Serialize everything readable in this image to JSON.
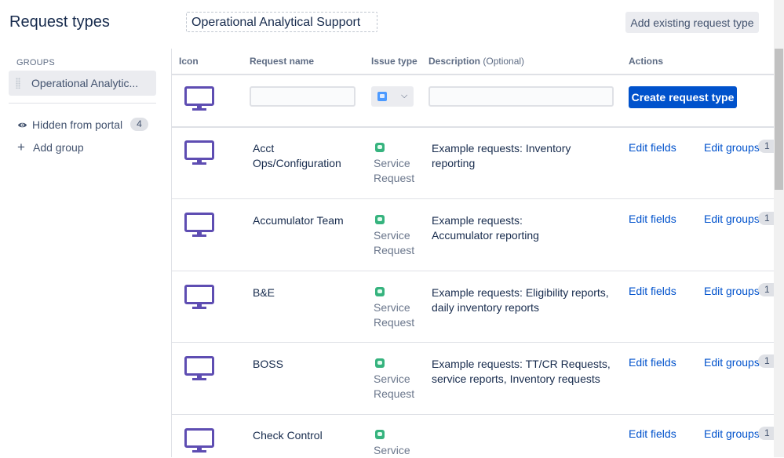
{
  "header": {
    "title": "Request types",
    "group_name": "Operational Analytical Support",
    "add_existing_label": "Add existing request type"
  },
  "sidebar": {
    "groups_heading": "GROUPS",
    "selected_group": "Operational Analytic...",
    "hidden_label": "Hidden from portal",
    "hidden_count": "4",
    "add_group_label": "Add group"
  },
  "table": {
    "columns": {
      "icon": "Icon",
      "request_name": "Request name",
      "issue_type": "Issue type",
      "description": "Description",
      "description_optional": "(Optional)",
      "actions": "Actions"
    },
    "create": {
      "name_value": "",
      "description_value": "",
      "button_label": "Create request type"
    },
    "rows": [
      {
        "name_l1": "Acct",
        "name_l2": "Ops/Configuration",
        "issue_l1": "Service",
        "issue_l2": "Request",
        "desc_l1": "Example requests: Inventory",
        "desc_l2": "reporting",
        "edit_fields": "Edit fields",
        "edit_groups": "Edit groups",
        "group_count": "1"
      },
      {
        "name_l1": "Accumulator Team",
        "name_l2": "",
        "issue_l1": "Service",
        "issue_l2": "Request",
        "desc_l1": "Example requests:",
        "desc_l2": "Accumulator reporting",
        "edit_fields": "Edit fields",
        "edit_groups": "Edit groups",
        "group_count": "1"
      },
      {
        "name_l1": "B&E",
        "name_l2": "",
        "issue_l1": "Service",
        "issue_l2": "Request",
        "desc_l1": "Example requests: Eligibility reports,",
        "desc_l2": "daily inventory reports",
        "edit_fields": "Edit fields",
        "edit_groups": "Edit groups",
        "group_count": "1"
      },
      {
        "name_l1": "BOSS",
        "name_l2": "",
        "issue_l1": "Service",
        "issue_l2": "Request",
        "desc_l1": "Example requests: TT/CR Requests,",
        "desc_l2": "service reports, Inventory requests",
        "edit_fields": "Edit fields",
        "edit_groups": "Edit groups",
        "group_count": "1"
      },
      {
        "name_l1": "Check Control",
        "name_l2": "",
        "issue_l1": "Service",
        "issue_l2": "",
        "desc_l1": "",
        "desc_l2": "",
        "edit_fields": "Edit fields",
        "edit_groups": "Edit groups",
        "group_count": "1"
      }
    ]
  },
  "colors": {
    "primary": "#0052cc",
    "icon_purple": "#5e4db2",
    "service_green": "#36b37e",
    "service_blue": "#4c9aff"
  },
  "icons": {
    "request_type": "monitor-icon",
    "hidden": "eye-icon",
    "add_group": "plus-icon",
    "drag": "drag-handle-icon",
    "select": "chevron-down-icon"
  }
}
